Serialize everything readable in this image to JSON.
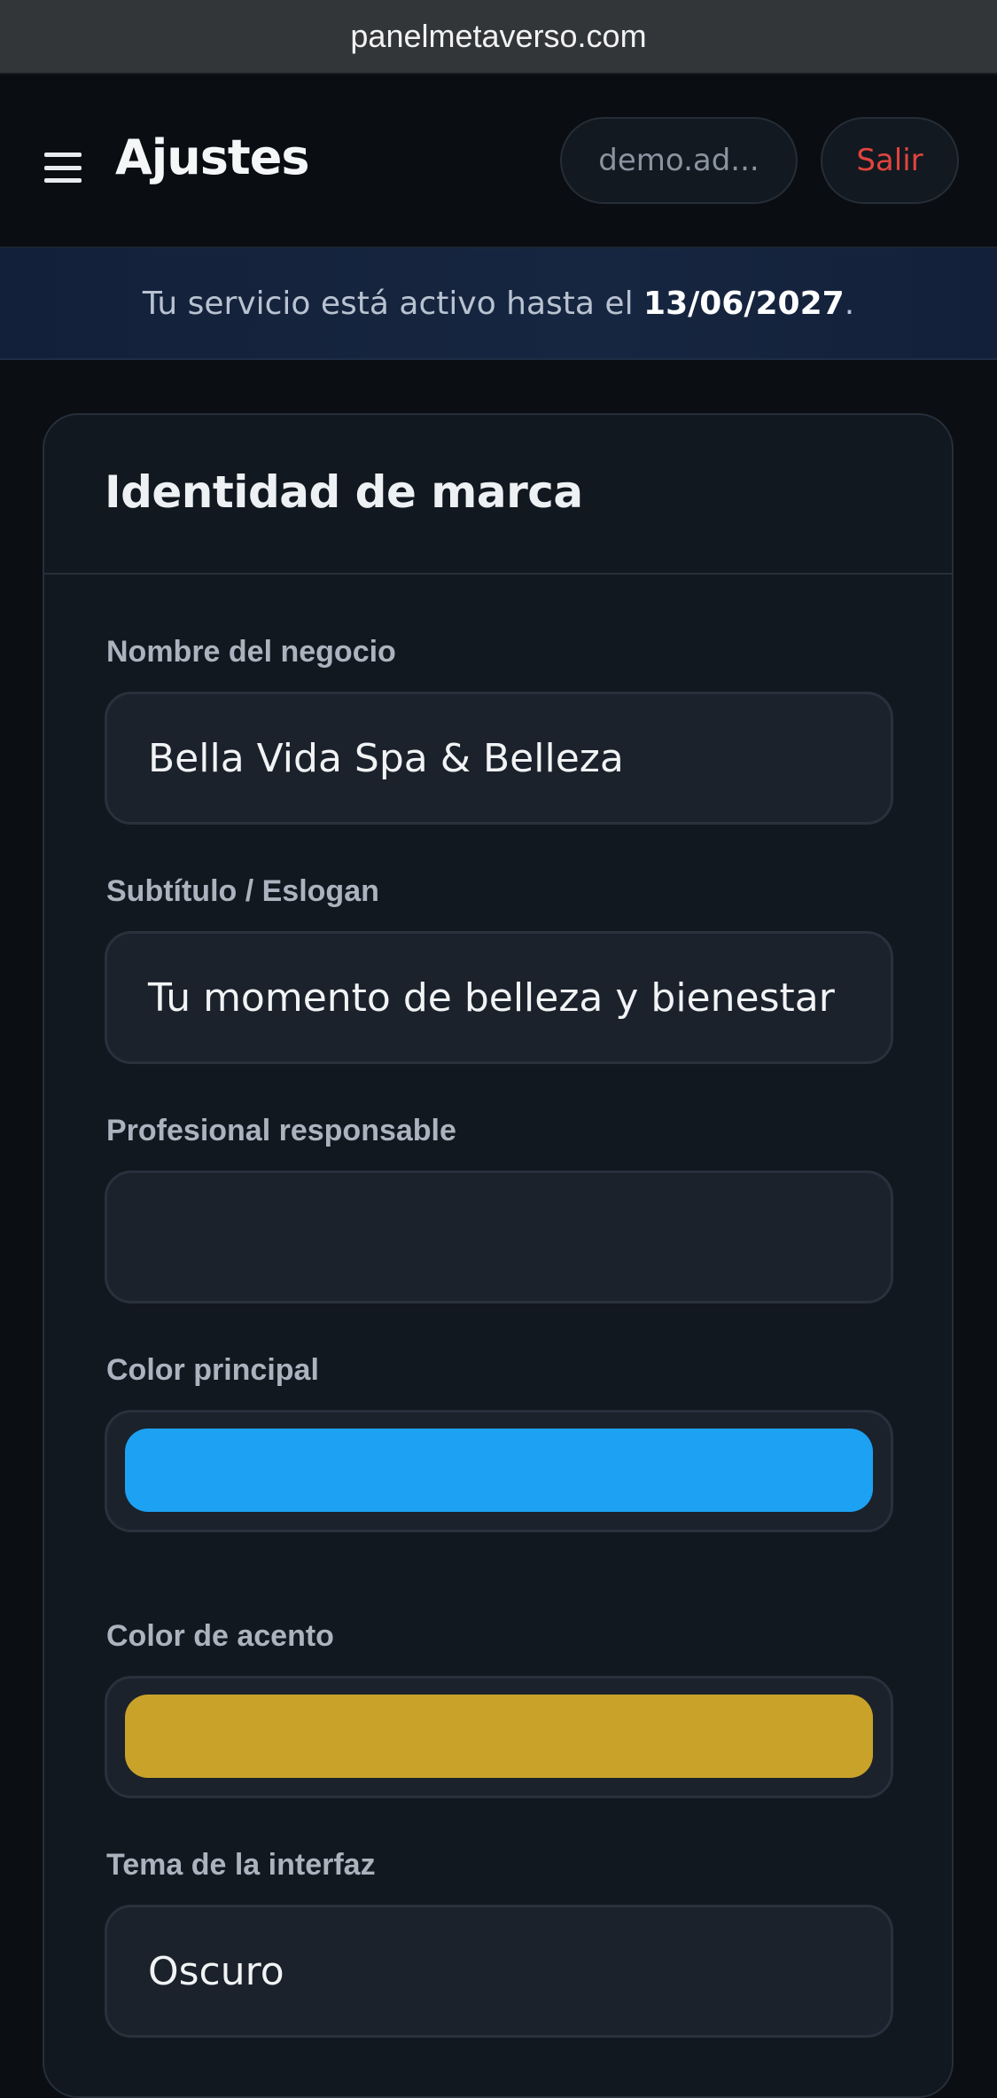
{
  "browser": {
    "url": "panelmetaverso.com"
  },
  "header": {
    "menu_icon": "hamburger-menu-icon",
    "title": "Ajustes",
    "user_label": "demo.ad...",
    "logout_label": "Salir"
  },
  "banner": {
    "prefix": "Tu servicio está activo hasta el ",
    "date": "13/06/2027",
    "suffix": "."
  },
  "card": {
    "title": "Identidad de marca",
    "fields": {
      "business_name": {
        "label": "Nombre del negocio",
        "value": "Bella Vida Spa & Belleza"
      },
      "subtitle": {
        "label": "Subtítulo / Eslogan",
        "value": "Tu momento de belleza y bienestar"
      },
      "professional": {
        "label": "Profesional responsable",
        "value": ""
      },
      "primary_color": {
        "label": "Color principal",
        "value": "#1da1f2"
      },
      "accent_color": {
        "label": "Color de acento",
        "value": "#c9a22a"
      },
      "theme": {
        "label": "Tema de la interfaz",
        "value": "Oscuro"
      }
    }
  }
}
